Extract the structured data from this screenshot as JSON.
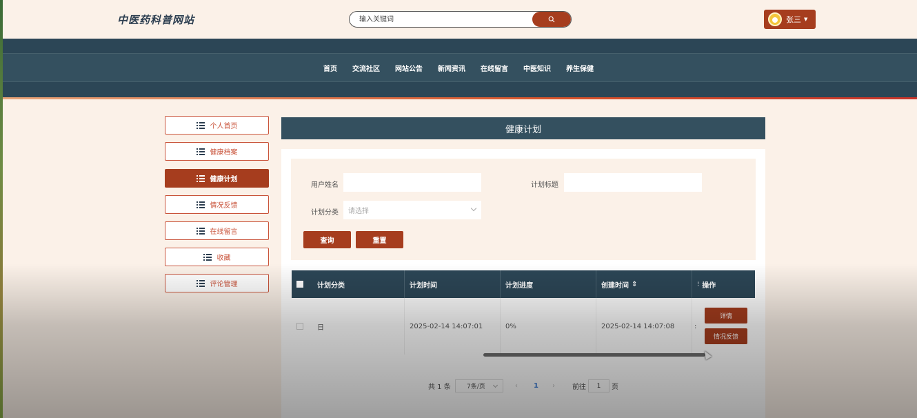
{
  "header": {
    "logo": "中医药科普网站",
    "search_placeholder": "输入关键词",
    "user_name": "张三"
  },
  "nav": [
    "首页",
    "交流社区",
    "网站公告",
    "新闻资讯",
    "在线留言",
    "中医知识",
    "养生保健"
  ],
  "sidebar": [
    {
      "label": "个人首页",
      "active": false
    },
    {
      "label": "健康档案",
      "active": false
    },
    {
      "label": "健康计划",
      "active": true
    },
    {
      "label": "情况反馈",
      "active": false
    },
    {
      "label": "在线留言",
      "active": false
    },
    {
      "label": "收藏",
      "active": false
    },
    {
      "label": "评论管理",
      "active": false
    }
  ],
  "panel": {
    "title": "健康计划",
    "filters": {
      "user_name_label": "用户姓名",
      "plan_title_label": "计划标题",
      "category_label": "计划分类",
      "category_placeholder": "请选择"
    },
    "query_button": "查询",
    "reset_button": "重置"
  },
  "table": {
    "columns": [
      "计划分类",
      "计划时间",
      "计划进度",
      "创建时间",
      "操作"
    ],
    "rows": [
      {
        "category": "日",
        "plan_time": "2025-02-14 14:07:01",
        "progress": "0%",
        "created": "2025-02-14 14:07:08",
        "created_tail": ":",
        "actions": [
          "详情",
          "情况反馈"
        ]
      }
    ],
    "sort_mark": "⇕",
    "ops_mark": "⁝"
  },
  "pagination": {
    "total": "共 1 条",
    "page_size": "7条/页",
    "prev": "‹",
    "current": "1",
    "next": "›",
    "goto_label": "前往",
    "goto_value": "1",
    "page_suffix": "页"
  },
  "colors": {
    "accent": "#a63d1e",
    "nav_bg": "#2c4656",
    "page_bg": "#fbf1e8"
  }
}
